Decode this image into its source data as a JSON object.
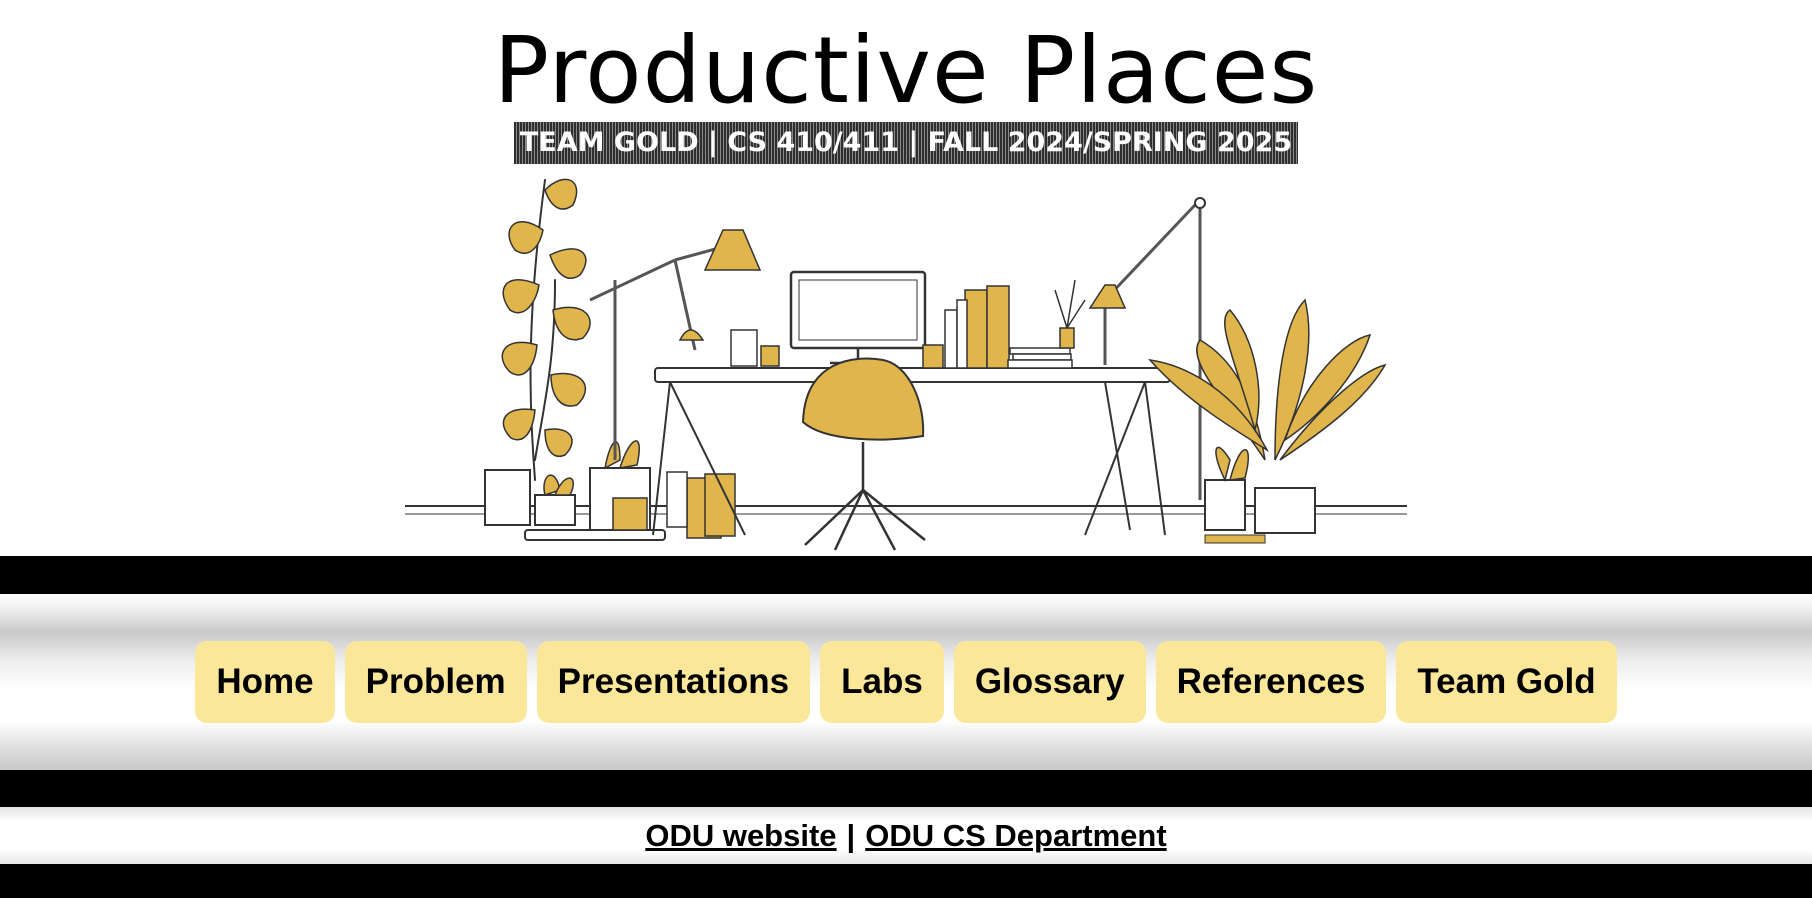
{
  "header": {
    "title": "Productive Places",
    "subtitle": "TEAM GOLD | CS 410/411 | FALL 2024/SPRING 2025"
  },
  "hero": {
    "description": "office desk illustration",
    "accent_color": "#e0b54c"
  },
  "nav": {
    "items": [
      {
        "label": "Home"
      },
      {
        "label": "Problem"
      },
      {
        "label": "Presentations"
      },
      {
        "label": "Labs"
      },
      {
        "label": "Glossary"
      },
      {
        "label": "References"
      },
      {
        "label": "Team Gold"
      }
    ],
    "button_color": "#fbe79a"
  },
  "footer": {
    "link1": "ODU website",
    "separator": "|",
    "link2": "ODU CS Department"
  }
}
